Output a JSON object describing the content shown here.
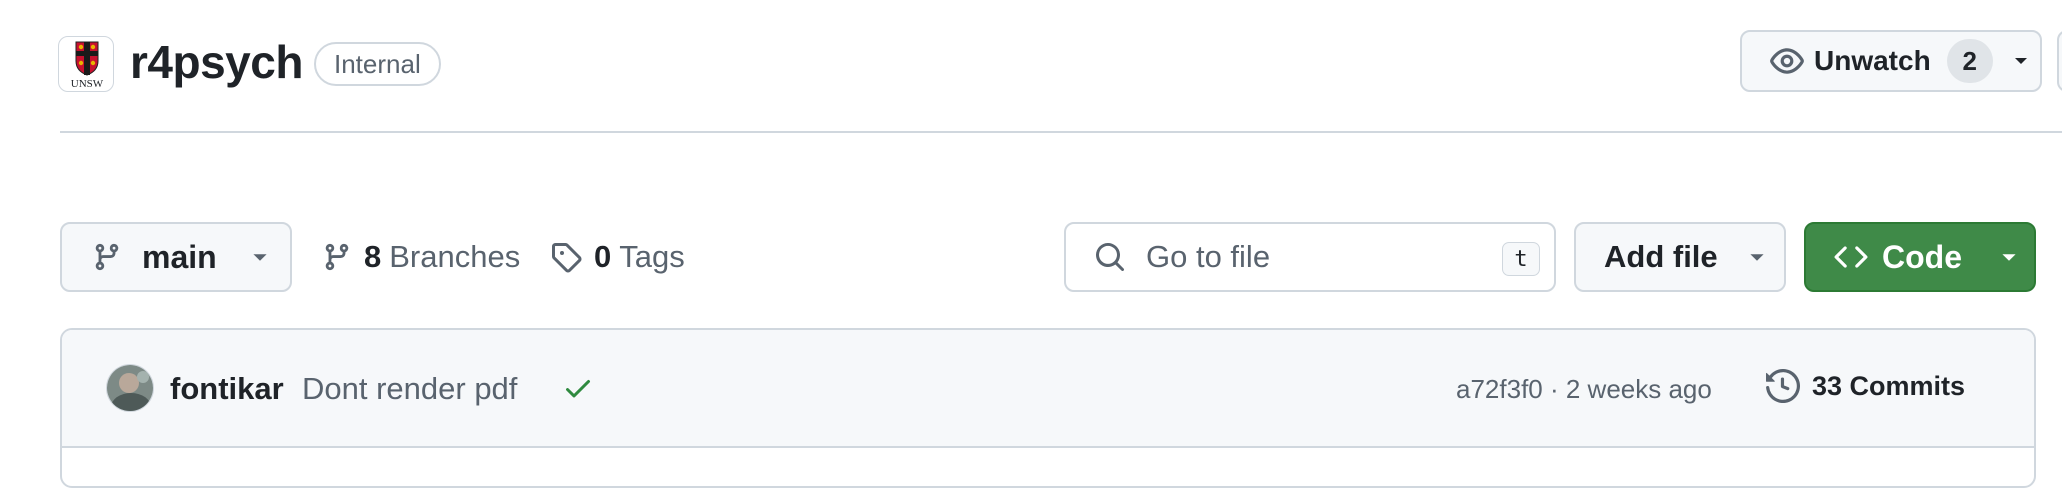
{
  "repo": {
    "logo_text": "UNSW",
    "name": "r4psych",
    "visibility": "Internal"
  },
  "watch": {
    "label": "Unwatch",
    "count": "2"
  },
  "branch": {
    "current": "main",
    "branches_count": "8",
    "branches_label": "Branches",
    "tags_count": "0",
    "tags_label": "Tags"
  },
  "search": {
    "placeholder": "Go to file",
    "shortcut": "t"
  },
  "actions": {
    "add_file": "Add file",
    "code": "Code"
  },
  "latest_commit": {
    "author": "fontikar",
    "message": "Dont render pdf",
    "meta": "a72f3f0 · 2 weeks ago",
    "commits_label": "33 Commits"
  },
  "colors": {
    "accent_green": "#3f8a48",
    "border": "#d0d7de",
    "muted_text": "#59636e",
    "success_check": "#2f8a3f"
  }
}
